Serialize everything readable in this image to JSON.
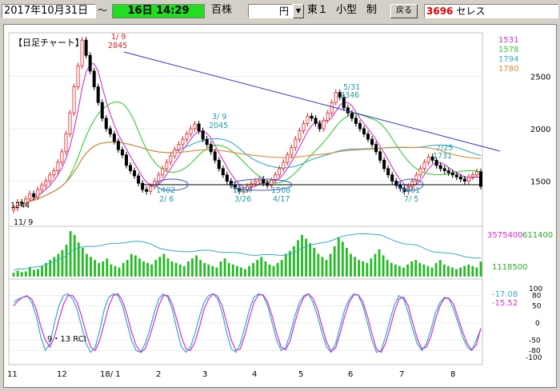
{
  "toolbar": {
    "date_from": "2017年10月31日",
    "tilde": "～",
    "time_display": "16日 14:29",
    "unit": "百株",
    "price_unit": "円",
    "market": "東１",
    "size_class": "小型",
    "system_label": "制",
    "back_label": "戻る",
    "code": "3696",
    "name": "セレス"
  },
  "chart_data": {
    "type": "line",
    "title": "【日足チャート】",
    "price_axis": {
      "ticks": [
        "2500",
        "2000",
        "1500"
      ],
      "ylim": [
        1100,
        2900
      ]
    },
    "ma_labels": [
      {
        "value": "1531",
        "color": "#cc33cc"
      },
      {
        "value": "1578",
        "color": "#33cc33"
      },
      {
        "value": "1794",
        "color": "#33aacc"
      },
      {
        "value": "1780",
        "color": "#dd8833"
      }
    ],
    "annotations": {
      "high1_date": "1/ 9",
      "high1_value": "2845",
      "low_value": "1244",
      "low_date": "11/ 9",
      "a39_date": "3/ 9",
      "a39_value": "2045",
      "a531_date": "5/31",
      "a531_value": "2346",
      "a725_date": "7/25",
      "a725_value": "1731",
      "l26_value": "1402",
      "l26_date": "2/ 6",
      "l326_value": "1404",
      "l326_date": "3/26",
      "l417_value": "1508",
      "l417_date": "4/17",
      "l75_value": "1401",
      "l75_date": "7/ 5"
    },
    "volume_labels": {
      "v1": "3575400",
      "v2": "611400",
      "v3": "1118500"
    },
    "rci": {
      "label": "9・13 RCI",
      "value1": "-17.08",
      "value1_color": "#33aacc",
      "value2": "-15.52",
      "value2_color": "#cc33cc",
      "axis": [
        "100",
        "80",
        "50",
        "0",
        "-50",
        "-80",
        "-100"
      ]
    },
    "x_ticks": [
      "11",
      "12",
      "18/ 1",
      "2",
      "3",
      "4",
      "5",
      "6",
      "7",
      "8"
    ],
    "series": [
      {
        "name": "",
        "values": [
          1244,
          1300,
          1290,
          1330,
          1380,
          1350,
          1420,
          1460,
          1500,
          1560,
          1600,
          1680,
          1780,
          1950,
          2150,
          2400,
          2600,
          2845,
          2700,
          2550,
          2400,
          2250,
          2100,
          2000,
          1950,
          1880,
          1800,
          1750,
          1650,
          1600,
          1550,
          1480,
          1420,
          1402,
          1450,
          1500,
          1560,
          1620,
          1680,
          1740,
          1800,
          1850,
          1900,
          1950,
          2000,
          2045,
          1980,
          1900,
          1850,
          1780,
          1700,
          1620,
          1560,
          1500,
          1460,
          1430,
          1404,
          1420,
          1450,
          1480,
          1500,
          1520,
          1480,
          1460,
          1508,
          1560,
          1620,
          1680,
          1750,
          1820,
          1900,
          1980,
          2050,
          2120,
          2100,
          2050,
          2000,
          2080,
          2150,
          2250,
          2346,
          2300,
          2200,
          2150,
          2100,
          2050,
          2000,
          1950,
          1900,
          1850,
          1780,
          1700,
          1620,
          1560,
          1500,
          1460,
          1430,
          1401,
          1450,
          1500,
          1560,
          1620,
          1680,
          1731,
          1700,
          1650,
          1620,
          1600,
          1580,
          1560,
          1540,
          1520,
          1500,
          1540,
          1560,
          1590,
          1450
        ]
      }
    ],
    "volume": [
      5,
      8,
      6,
      7,
      12,
      9,
      10,
      14,
      18,
      22,
      26,
      30,
      35,
      42,
      60,
      55,
      45,
      38,
      30,
      26,
      22,
      18,
      20,
      24,
      16,
      14,
      12,
      18,
      22,
      30,
      28,
      24,
      20,
      18,
      16,
      22,
      26,
      30,
      24,
      20,
      18,
      16,
      14,
      20,
      24,
      28,
      22,
      18,
      16,
      14,
      12,
      20,
      24,
      18,
      16,
      14,
      12,
      10,
      14,
      18,
      22,
      26,
      20,
      16,
      14,
      18,
      22,
      30,
      34,
      40,
      48,
      55,
      50,
      44,
      38,
      30,
      26,
      22,
      30,
      40,
      52,
      46,
      38,
      30,
      26,
      22,
      20,
      18,
      24,
      30,
      36,
      28,
      22,
      18,
      16,
      14,
      12,
      16,
      20,
      22,
      18,
      16,
      14,
      12,
      18,
      22,
      16,
      14,
      12,
      10,
      12,
      14,
      16,
      14,
      12,
      20
    ],
    "rci_series": [
      {
        "name": "",
        "values": [
          60,
          70,
          75,
          80,
          60,
          20,
          -40,
          -80,
          -60,
          0,
          50,
          80,
          85,
          70,
          40,
          -10,
          -60,
          -85,
          -70,
          -20,
          40,
          75,
          85,
          80,
          50,
          0,
          -50,
          -80,
          -85,
          -60,
          -20,
          30,
          70,
          85,
          75,
          40,
          -20,
          -70,
          -85,
          -70,
          -30,
          20,
          60,
          80,
          85,
          70,
          30,
          -30,
          -75,
          -85,
          -60,
          -10,
          40,
          75,
          85,
          80,
          50,
          0,
          -50,
          -80,
          -70,
          -30,
          20,
          60,
          80,
          85,
          60,
          20,
          -30,
          -70,
          -85,
          -60,
          -10,
          40,
          70,
          85,
          80,
          50,
          0,
          -50,
          -85,
          -80,
          -40,
          10,
          55,
          80,
          70,
          30,
          -20,
          -60,
          -80,
          -60,
          -20,
          30,
          60,
          75,
          70,
          40,
          0,
          -40,
          -70,
          -80,
          -50,
          -17
        ]
      },
      {
        "name": "",
        "values": [
          50,
          65,
          75,
          78,
          70,
          40,
          -10,
          -50,
          -70,
          -40,
          10,
          55,
          80,
          80,
          60,
          20,
          -30,
          -70,
          -80,
          -50,
          0,
          50,
          80,
          85,
          65,
          25,
          -25,
          -65,
          -85,
          -75,
          -40,
          5,
          50,
          80,
          80,
          55,
          10,
          -40,
          -75,
          -80,
          -55,
          -10,
          40,
          70,
          85,
          78,
          50,
          0,
          -50,
          -80,
          -75,
          -35,
          15,
          60,
          82,
          82,
          62,
          20,
          -30,
          -70,
          -78,
          -50,
          0,
          45,
          75,
          85,
          72,
          40,
          -10,
          -55,
          -82,
          -72,
          -30,
          20,
          60,
          82,
          82,
          62,
          20,
          -30,
          -75,
          -85,
          -60,
          -15,
          35,
          70,
          75,
          50,
          0,
          -45,
          -75,
          -70,
          -40,
          10,
          50,
          72,
          72,
          55,
          15,
          -25,
          -60,
          -78,
          -65,
          -15
        ]
      }
    ]
  }
}
